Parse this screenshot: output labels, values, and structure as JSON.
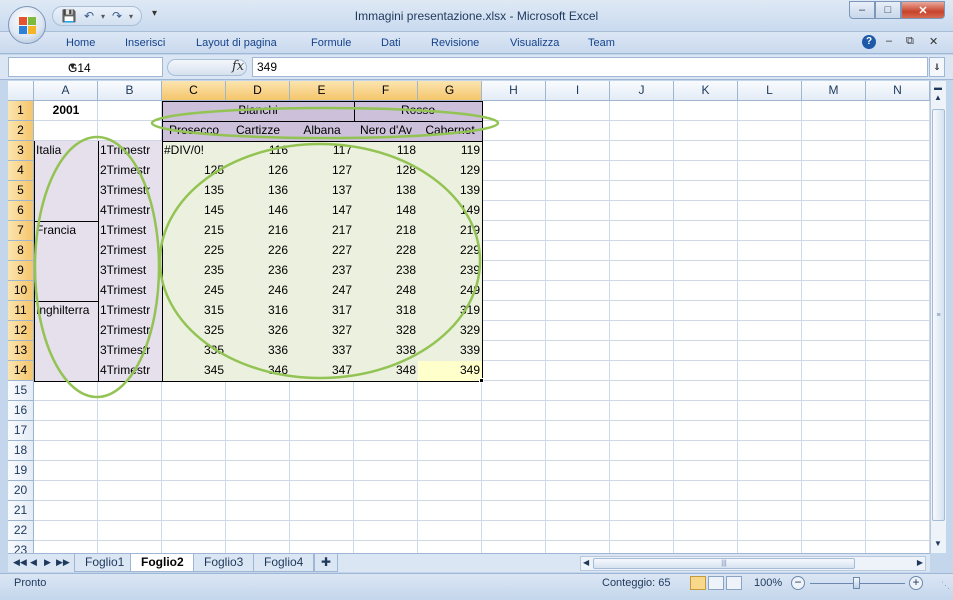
{
  "window": {
    "title": "Immagini presentazione.xlsx - Microsoft Excel"
  },
  "ribbon": {
    "tabs": [
      "Home",
      "Inserisci",
      "Layout di pagina",
      "Formule",
      "Dati",
      "Revisione",
      "Visualizza",
      "Team"
    ]
  },
  "formula_bar": {
    "name_box": "G14",
    "fx_label": "fx",
    "formula": "349"
  },
  "grid": {
    "columns": [
      "A",
      "B",
      "C",
      "D",
      "E",
      "F",
      "G",
      "H",
      "I",
      "J",
      "K",
      "L",
      "M",
      "N"
    ],
    "selected_columns": [
      "C",
      "D",
      "E",
      "F",
      "G"
    ],
    "rows": [
      "1",
      "2",
      "3",
      "4",
      "5",
      "6",
      "7",
      "8",
      "9",
      "10",
      "11",
      "12",
      "13",
      "14",
      "15",
      "16",
      "17",
      "18",
      "19",
      "20",
      "21",
      "22",
      "23"
    ],
    "selected_rows": [
      "1",
      "2",
      "3",
      "4",
      "5",
      "6",
      "7",
      "8",
      "9",
      "10",
      "11",
      "12",
      "13",
      "14"
    ],
    "year": "2001",
    "group_headers": [
      "Bianchi",
      "Rosso"
    ],
    "wine_headers": [
      "Prosecco",
      "Cartizze",
      "Albana",
      "Nero d'Av",
      "Cabernet"
    ],
    "countries": [
      "Italia",
      "Francia",
      "Inghilterra"
    ],
    "quarters": [
      "1Trimestr",
      "2Trimestr",
      "3Trimestr",
      "4Trimestr",
      "1Trimest",
      "2Trimest",
      "3Trimest",
      "4Trimest",
      "1Trimestr",
      "2Trimestr",
      "3Trimestr",
      "4Trimestr"
    ],
    "values": [
      [
        "#DIV/0!",
        "116",
        "117",
        "118",
        "119"
      ],
      [
        "125",
        "126",
        "127",
        "128",
        "129"
      ],
      [
        "135",
        "136",
        "137",
        "138",
        "139"
      ],
      [
        "145",
        "146",
        "147",
        "148",
        "149"
      ],
      [
        "215",
        "216",
        "217",
        "218",
        "219"
      ],
      [
        "225",
        "226",
        "227",
        "228",
        "229"
      ],
      [
        "235",
        "236",
        "237",
        "238",
        "239"
      ],
      [
        "245",
        "246",
        "247",
        "248",
        "249"
      ],
      [
        "315",
        "316",
        "317",
        "318",
        "319"
      ],
      [
        "325",
        "326",
        "327",
        "328",
        "329"
      ],
      [
        "335",
        "336",
        "337",
        "338",
        "339"
      ],
      [
        "345",
        "346",
        "347",
        "348",
        "349"
      ]
    ]
  },
  "sheet_tabs": [
    {
      "label": "Foglio1",
      "active": false
    },
    {
      "label": "Foglio2",
      "active": true
    },
    {
      "label": "Foglio3",
      "active": false
    },
    {
      "label": "Foglio4",
      "active": false
    }
  ],
  "status": {
    "ready": "Pronto",
    "count": "Conteggio: 65",
    "zoom": "100%"
  },
  "colors": {
    "lavender": "#e5e0ec",
    "header_purple": "#ccc0da",
    "green_fill": "#ebf1de",
    "annotation": "#92c353",
    "selected_header": "#f5c56b"
  },
  "icons": [
    "office-button-icon",
    "save-icon",
    "undo-icon",
    "redo-icon",
    "help-icon",
    "fx-icon"
  ]
}
